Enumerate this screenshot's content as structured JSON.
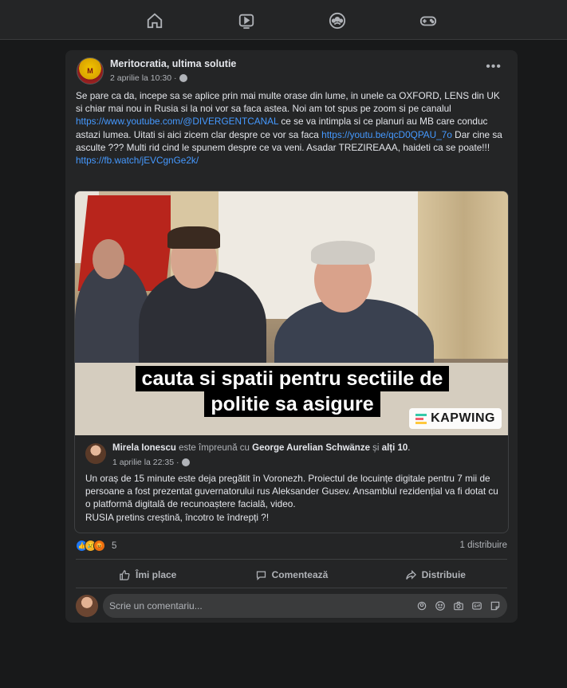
{
  "post": {
    "page_name": "Meritocratia, ultima solutie",
    "avatar_text": "M",
    "date": "2 aprilie la 10:30 ·",
    "text_1": "Se pare ca da, incepe sa se aplice prin mai multe orase din lume, in unele ca OXFORD, LENS din UK si chiar mai nou in Rusia si la noi vor sa faca astea. Noi am tot spus pe zoom si pe canalul ",
    "link_1": "https://www.youtube.com/@DIVERGENTCANAL",
    "text_2": " ce se va intimpla si ce planuri au MB care conduc astazi lumea. Uitati si aici zicem clar despre ce vor sa faca ",
    "link_2": "https://youtu.be/qcD0QPAU_7o",
    "text_3": " Dar cine sa asculte ??? Multi rid cind le spunem despre ce va veni. Asadar TREZIREAAA, haideti ca se poate!!!",
    "link_3": "https://fb.watch/jEVCgnGe2k/"
  },
  "video": {
    "caption_line1": "cauta si spatii pentru sectiile de",
    "caption_line2": "politie sa asigure",
    "watermark": "KAPWING"
  },
  "shared": {
    "author": "Mirela Ionescu",
    "with_text": " este împreună cu ",
    "tagged": "George Aurelian Schwänze",
    "and_text": " și ",
    "others": "alți 10",
    "period": ".",
    "date": "1 aprilie la 22:35 ·",
    "text_1": "Un oraș de 15 minute este deja pregătit în Voronezh. Proiectul de locuințe digitale pentru 7 mii de persoane a fost prezentat guvernatorului rus Aleksander Gusev. Ansamblul rezidențial va fi dotat cu o platformă digitală de recunoaștere facială, video.",
    "text_2": "RUSIA pretins creștină, încotro te îndrepți ?!"
  },
  "stats": {
    "reaction_count": "5",
    "shares": "1 distribuire"
  },
  "actions": {
    "like": "Îmi place",
    "comment": "Comentează",
    "share": "Distribuie"
  },
  "comment_box": {
    "placeholder": "Scrie un comentariu..."
  },
  "nav": [
    "home-icon",
    "video-icon",
    "groups-icon",
    "gaming-icon"
  ],
  "colors": {
    "link": "#4599ff",
    "card": "#242526",
    "background": "#18191a"
  }
}
